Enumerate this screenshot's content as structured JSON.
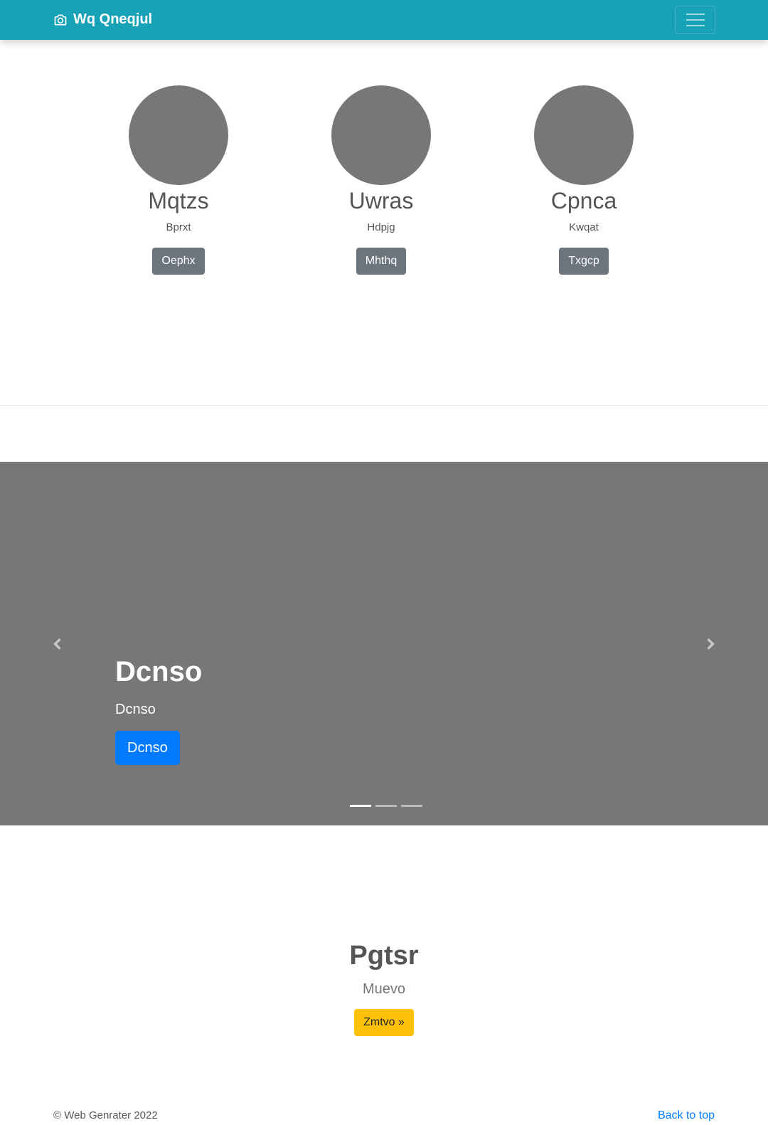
{
  "navbar": {
    "brand": "Wq Qneqjul",
    "brand_icon": "camera-icon",
    "toggler_icon": "hamburger-menu-icon",
    "background": "#17a2b8"
  },
  "features": [
    {
      "name": "Mqtzs",
      "subtitle": "Bprxt",
      "button": "Oephx"
    },
    {
      "name": "Uwras",
      "subtitle": "Hdpjg",
      "button": "Mhthq"
    },
    {
      "name": "Cpnca",
      "subtitle": "Kwqat",
      "button": "Txgcp"
    }
  ],
  "carousel": {
    "title": "Dcnso",
    "text": "Dcnso",
    "button": "Dcnso",
    "prev_icon": "chevron-left-icon",
    "next_icon": "chevron-right-icon",
    "slide_count": 3,
    "active_slide": 1
  },
  "hero": {
    "title": "Pgtsr",
    "subtitle": "Muevo",
    "button": "Zmtvo »"
  },
  "footer": {
    "copyright": "© Web Genrater 2022",
    "back_to_top": "Back to top"
  }
}
